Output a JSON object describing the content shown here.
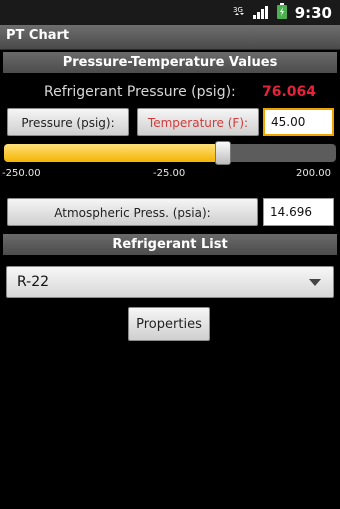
{
  "status_bar": {
    "time": "9:30"
  },
  "app_title": "PT Chart",
  "section_pt": "Pressure-Temperature Values",
  "refrigerant_pressure_label": "Refrigerant Pressure (psig):",
  "refrigerant_pressure_value": "76.064",
  "pressure_button": "Pressure (psig):",
  "temperature_button": "Temperature (F):",
  "temperature_input_value": "45.00",
  "slider": {
    "min_label": "-250.00",
    "mid_label": "-25.00",
    "max_label": "200.00",
    "fill_fraction": 0.66
  },
  "atmospheric_button": "Atmospheric Press. (psia):",
  "atmospheric_input_value": "14.696",
  "section_list": "Refrigerant List",
  "refrigerant_select_value": "R-22",
  "properties_button": "Properties",
  "colors": {
    "accent": "#f4b400",
    "red_value": "#e8223a",
    "button_red": "#d23b3b"
  }
}
